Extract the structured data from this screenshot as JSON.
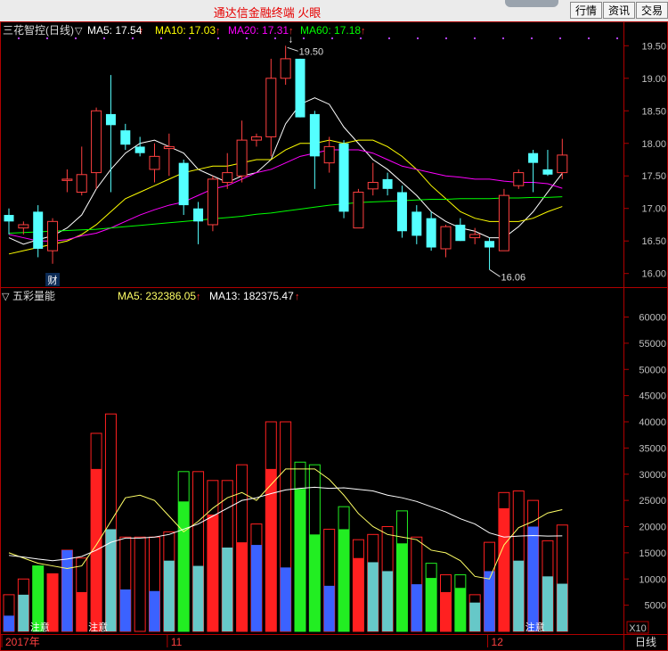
{
  "app": {
    "title": "通达信金融终端  火眼",
    "buttons": [
      "行情",
      "资讯",
      "交易"
    ]
  },
  "chart_data": [
    {
      "type": "candlestick",
      "title": "三花智控(日线)",
      "indicators": [
        {
          "label": "MA5: 17.54",
          "color": "#ffffff"
        },
        {
          "label": "MA10: 17.03",
          "color": "#ffff00"
        },
        {
          "label": "MA20: 17.31",
          "color": "#ff00ff"
        },
        {
          "label": "MA60: 17.18",
          "color": "#00ff00"
        }
      ],
      "ylim": [
        15.9,
        19.6
      ],
      "yticks": [
        "19.50",
        "19.00",
        "18.50",
        "18.00",
        "17.50",
        "17.00",
        "16.50",
        "16.00"
      ],
      "ytick_values": [
        19.5,
        19.0,
        18.5,
        18.0,
        17.5,
        17.0,
        16.5,
        16.0
      ],
      "annotations": {
        "high_label": "19.50",
        "low_label": "16.06",
        "finance_marker": "财"
      },
      "candles": [
        {
          "o": 16.9,
          "h": 17.0,
          "l": 16.6,
          "c": 16.8
        },
        {
          "o": 16.7,
          "h": 16.8,
          "l": 16.6,
          "c": 16.75
        },
        {
          "o": 16.95,
          "h": 17.05,
          "l": 16.25,
          "c": 16.38
        },
        {
          "o": 16.35,
          "h": 16.85,
          "l": 16.15,
          "c": 16.8
        },
        {
          "o": 17.43,
          "h": 17.6,
          "l": 17.25,
          "c": 17.45
        },
        {
          "o": 17.25,
          "h": 17.95,
          "l": 17.2,
          "c": 17.52
        },
        {
          "o": 17.55,
          "h": 18.55,
          "l": 17.3,
          "c": 18.5
        },
        {
          "o": 18.45,
          "h": 19.05,
          "l": 17.25,
          "c": 18.28
        },
        {
          "o": 18.2,
          "h": 18.3,
          "l": 17.9,
          "c": 17.98
        },
        {
          "o": 17.95,
          "h": 18.1,
          "l": 17.8,
          "c": 17.85
        },
        {
          "o": 17.6,
          "h": 18.0,
          "l": 17.4,
          "c": 17.8
        },
        {
          "o": 17.92,
          "h": 18.15,
          "l": 17.5,
          "c": 17.95
        },
        {
          "o": 17.7,
          "h": 17.75,
          "l": 16.9,
          "c": 17.05
        },
        {
          "o": 17.0,
          "h": 17.1,
          "l": 16.45,
          "c": 16.8
        },
        {
          "o": 16.75,
          "h": 17.5,
          "l": 16.65,
          "c": 17.45
        },
        {
          "o": 17.4,
          "h": 17.85,
          "l": 17.3,
          "c": 17.55
        },
        {
          "o": 17.5,
          "h": 18.35,
          "l": 17.4,
          "c": 18.05
        },
        {
          "o": 18.05,
          "h": 18.15,
          "l": 17.95,
          "c": 18.1
        },
        {
          "o": 18.1,
          "h": 19.3,
          "l": 17.8,
          "c": 19.0
        },
        {
          "o": 19.0,
          "h": 19.5,
          "l": 18.9,
          "c": 19.3
        },
        {
          "o": 19.3,
          "h": 19.3,
          "l": 18.4,
          "c": 18.4
        },
        {
          "o": 18.45,
          "h": 18.5,
          "l": 17.3,
          "c": 17.8
        },
        {
          "o": 17.7,
          "h": 18.1,
          "l": 17.55,
          "c": 17.95
        },
        {
          "o": 18.0,
          "h": 18.05,
          "l": 16.85,
          "c": 16.95
        },
        {
          "o": 16.7,
          "h": 17.3,
          "l": 16.7,
          "c": 17.25
        },
        {
          "o": 17.3,
          "h": 17.7,
          "l": 17.2,
          "c": 17.4
        },
        {
          "o": 17.45,
          "h": 17.55,
          "l": 17.2,
          "c": 17.3
        },
        {
          "o": 17.25,
          "h": 17.35,
          "l": 16.55,
          "c": 16.65
        },
        {
          "o": 16.95,
          "h": 17.05,
          "l": 16.45,
          "c": 16.58
        },
        {
          "o": 16.85,
          "h": 16.95,
          "l": 16.35,
          "c": 16.4
        },
        {
          "o": 16.38,
          "h": 16.75,
          "l": 16.25,
          "c": 16.72
        },
        {
          "o": 16.75,
          "h": 16.85,
          "l": 16.5,
          "c": 16.5
        },
        {
          "o": 16.55,
          "h": 16.7,
          "l": 16.45,
          "c": 16.6
        },
        {
          "o": 16.5,
          "h": 16.55,
          "l": 16.06,
          "c": 16.4
        },
        {
          "o": 16.35,
          "h": 17.3,
          "l": 16.35,
          "c": 17.2
        },
        {
          "o": 17.35,
          "h": 17.6,
          "l": 17.3,
          "c": 17.55
        },
        {
          "o": 17.85,
          "h": 17.9,
          "l": 17.25,
          "c": 17.7
        },
        {
          "o": 17.6,
          "h": 17.9,
          "l": 17.5,
          "c": 17.52
        },
        {
          "o": 17.55,
          "h": 18.07,
          "l": 17.45,
          "c": 17.82
        }
      ],
      "series": [
        {
          "name": "MA5",
          "color": "#ffffff",
          "values": [
            16.55,
            16.45,
            16.52,
            16.58,
            16.7,
            16.9,
            17.3,
            17.6,
            17.85,
            18.0,
            18.05,
            17.95,
            17.85,
            17.6,
            17.5,
            17.4,
            17.5,
            17.55,
            17.75,
            18.3,
            18.6,
            18.7,
            18.6,
            18.25,
            18.0,
            17.75,
            17.6,
            17.4,
            17.2,
            16.95,
            16.8,
            16.7,
            16.65,
            16.55,
            16.55,
            16.72,
            16.95,
            17.25,
            17.54
          ]
        },
        {
          "name": "MA10",
          "color": "#ffff00",
          "values": [
            16.3,
            16.35,
            16.4,
            16.45,
            16.5,
            16.6,
            16.75,
            16.95,
            17.15,
            17.25,
            17.35,
            17.45,
            17.55,
            17.6,
            17.65,
            17.65,
            17.7,
            17.75,
            17.75,
            17.9,
            18.0,
            18.0,
            18.05,
            18.0,
            18.05,
            18.05,
            17.95,
            17.8,
            17.6,
            17.35,
            17.15,
            16.95,
            16.85,
            16.8,
            16.8,
            16.8,
            16.85,
            16.95,
            17.03
          ]
        },
        {
          "name": "MA20",
          "color": "#ff00ff",
          "values": [
            16.6,
            16.55,
            16.5,
            16.5,
            16.52,
            16.58,
            16.62,
            16.7,
            16.8,
            16.9,
            16.98,
            17.05,
            17.1,
            17.2,
            17.3,
            17.35,
            17.45,
            17.55,
            17.6,
            17.7,
            17.8,
            17.85,
            17.9,
            17.9,
            17.9,
            17.85,
            17.75,
            17.65,
            17.6,
            17.55,
            17.5,
            17.48,
            17.45,
            17.45,
            17.42,
            17.4,
            17.4,
            17.38,
            17.31
          ]
        },
        {
          "name": "MA60",
          "color": "#00ff00",
          "values": [
            16.62,
            16.63,
            16.64,
            16.65,
            16.66,
            16.67,
            16.68,
            16.7,
            16.72,
            16.74,
            16.76,
            16.78,
            16.8,
            16.82,
            16.84,
            16.86,
            16.88,
            16.91,
            16.93,
            16.96,
            16.99,
            17.02,
            17.05,
            17.07,
            17.09,
            17.1,
            17.11,
            17.12,
            17.13,
            17.14,
            17.14,
            17.15,
            17.15,
            17.15,
            17.16,
            17.16,
            17.17,
            17.17,
            17.18
          ]
        }
      ]
    },
    {
      "type": "bar",
      "title": "五彩量能",
      "indicators": [
        {
          "label": "MA5: 232386.05",
          "color": "#ffff66"
        },
        {
          "label": "MA13: 182375.47",
          "color": "#ffffff"
        }
      ],
      "ylim": [
        0,
        64000
      ],
      "yticks": [
        "60000",
        "55000",
        "50000",
        "45000",
        "40000",
        "35000",
        "30000",
        "25000",
        "20000",
        "15000",
        "10000",
        "5000"
      ],
      "ytick_values": [
        60000,
        55000,
        50000,
        45000,
        40000,
        35000,
        30000,
        25000,
        20000,
        15000,
        10000,
        5000
      ],
      "unit_label": "X10",
      "bars": [
        {
          "outer": 7000,
          "inner": 3000,
          "color": "#3b62ff"
        },
        {
          "outer": 10000,
          "inner": 7000,
          "color": "#66c8c8"
        },
        {
          "outer": 12500,
          "inner": 12500,
          "color": "#22ee22"
        },
        {
          "outer": 11000,
          "inner": 11000,
          "color": "#ff2020"
        },
        {
          "outer": 15500,
          "inner": 15500,
          "color": "#3b62ff"
        },
        {
          "outer": 14000,
          "inner": 7500,
          "color": "#ff2020"
        },
        {
          "outer": 37800,
          "inner": 31000,
          "color": "#ff2020"
        },
        {
          "outer": 41500,
          "inner": 19500,
          "color": "#66c8c8"
        },
        {
          "outer": 18000,
          "inner": 8000,
          "color": "#3b62ff"
        },
        {
          "outer": 18000,
          "inner": 0,
          "color": "#ff2020"
        },
        {
          "outer": 18000,
          "inner": 7700,
          "color": "#3b62ff"
        },
        {
          "outer": 19000,
          "inner": 13500,
          "color": "#66c8c8"
        },
        {
          "outer": 30500,
          "inner": 24800,
          "color": "#22ee22"
        },
        {
          "outer": 30500,
          "inner": 12500,
          "color": "#66c8c8"
        },
        {
          "outer": 28800,
          "inner": 22300,
          "color": "#ff2020"
        },
        {
          "outer": 28800,
          "inner": 16000,
          "color": "#66c8c8"
        },
        {
          "outer": 31800,
          "inner": 17000,
          "color": "#ff2020"
        },
        {
          "outer": 20500,
          "inner": 16500,
          "color": "#3b62ff"
        },
        {
          "outer": 40000,
          "inner": 31000,
          "color": "#ff2020"
        },
        {
          "outer": 40000,
          "inner": 12200,
          "color": "#3b62ff"
        },
        {
          "outer": 32300,
          "inner": 27200,
          "color": "#22ee22"
        },
        {
          "outer": 31800,
          "inner": 18500,
          "color": "#22ee22"
        },
        {
          "outer": 19500,
          "inner": 8700,
          "color": "#3b62ff"
        },
        {
          "outer": 23800,
          "inner": 19500,
          "color": "#22ee22"
        },
        {
          "outer": 17500,
          "inner": 14000,
          "color": "#ff2020"
        },
        {
          "outer": 18500,
          "inner": 13200,
          "color": "#66c8c8"
        },
        {
          "outer": 20000,
          "inner": 11500,
          "color": "#66c8c8"
        },
        {
          "outer": 23000,
          "inner": 16800,
          "color": "#22ee22"
        },
        {
          "outer": 18000,
          "inner": 9000,
          "color": "#3b62ff"
        },
        {
          "outer": 13000,
          "inner": 10200,
          "color": "#22ee22"
        },
        {
          "outer": 10800,
          "inner": 7500,
          "color": "#ff2020"
        },
        {
          "outer": 10800,
          "inner": 8300,
          "color": "#22ee22"
        },
        {
          "outer": 7000,
          "inner": 5500,
          "color": "#66c8c8"
        },
        {
          "outer": 17000,
          "inner": 11500,
          "color": "#3b62ff"
        },
        {
          "outer": 26500,
          "inner": 23500,
          "color": "#ff2020"
        },
        {
          "outer": 26800,
          "inner": 13500,
          "color": "#66c8c8"
        },
        {
          "outer": 25000,
          "inner": 20000,
          "color": "#3b62ff"
        },
        {
          "outer": 17300,
          "inner": 10500,
          "color": "#66c8c8"
        },
        {
          "outer": 20300,
          "inner": 9100,
          "color": "#66c8c8"
        }
      ],
      "series": [
        {
          "name": "MA5",
          "color": "#ffff66",
          "values": [
            15000,
            14000,
            13000,
            12500,
            12000,
            12500,
            16500,
            21000,
            25500,
            26000,
            25000,
            22000,
            19000,
            21000,
            23500,
            25500,
            26500,
            25000,
            28000,
            31000,
            31000,
            31000,
            29000,
            26000,
            22500,
            20000,
            18500,
            18000,
            17500,
            15500,
            15000,
            13500,
            10500,
            10000,
            16500,
            19800,
            21000,
            22600,
            23238
          ]
        },
        {
          "name": "MA13",
          "color": "#ffffff",
          "values": [
            14500,
            14200,
            13800,
            13500,
            13800,
            14300,
            15500,
            17000,
            17800,
            17800,
            18000,
            18500,
            19500,
            20500,
            22000,
            23500,
            25000,
            25500,
            26300,
            27000,
            27300,
            27500,
            27300,
            27400,
            27100,
            26800,
            26000,
            25500,
            24800,
            23800,
            22800,
            21500,
            20500,
            18800,
            18000,
            18200,
            18300,
            18200,
            18237
          ]
        }
      ],
      "markers": [
        {
          "index": 2,
          "label": "注意"
        },
        {
          "index": 6,
          "label": "注意"
        },
        {
          "index": 36,
          "label": "注意"
        }
      ]
    }
  ],
  "xaxis": {
    "labels": [
      {
        "index": 0,
        "text": "2017年"
      },
      {
        "index": 11,
        "text": "11"
      },
      {
        "index": 33,
        "text": "12"
      }
    ],
    "corner_label": "日线"
  }
}
